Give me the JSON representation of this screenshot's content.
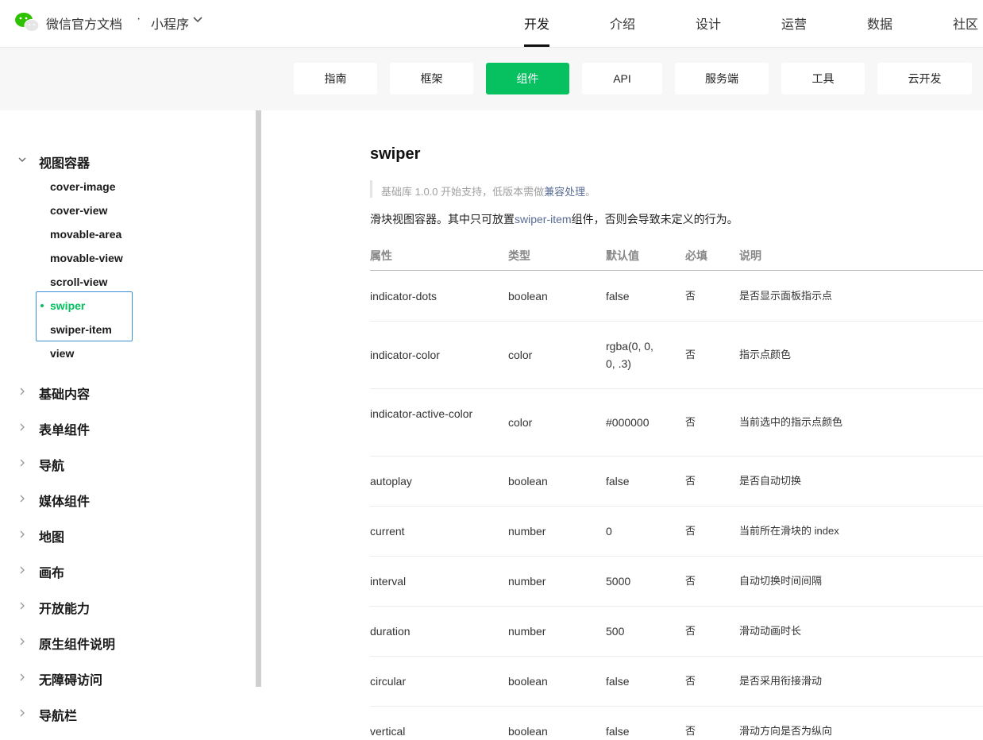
{
  "header": {
    "brand": "微信官方文档",
    "dot": "·",
    "section": "小程序",
    "nav": [
      "开发",
      "介绍",
      "设计",
      "运营",
      "数据",
      "社区"
    ]
  },
  "subnav": [
    "指南",
    "框架",
    "组件",
    "API",
    "服务端",
    "工具",
    "云开发"
  ],
  "sidebar": {
    "open_category": "视图容器",
    "items": [
      "cover-image",
      "cover-view",
      "movable-area",
      "movable-view",
      "scroll-view",
      "swiper",
      "swiper-item",
      "view"
    ],
    "categories": [
      "基础内容",
      "表单组件",
      "导航",
      "媒体组件",
      "地图",
      "画布",
      "开放能力",
      "原生组件说明",
      "无障碍访问",
      "导航栏"
    ]
  },
  "content": {
    "title": "swiper",
    "note_prefix": "基础库 1.0.0 开始支持，低版本需做",
    "note_link": "兼容处理",
    "note_suffix": "。",
    "desc_prefix": "滑块视图容器。其中只可放置",
    "desc_link": "swiper-item",
    "desc_suffix": "组件，否则会导致未定义的行为。",
    "columns": [
      "属性",
      "类型",
      "默认值",
      "必填",
      "说明"
    ],
    "rows": [
      {
        "attr": "indicator-dots",
        "type": "boolean",
        "default": "false",
        "required": "否",
        "desc": "是否显示面板指示点"
      },
      {
        "attr": "indicator-color",
        "type": "color",
        "default": "rgba(0, 0, 0, .3)",
        "required": "否",
        "desc": "指示点颜色"
      },
      {
        "attr": "indicator-active-color",
        "type": "color",
        "default": "#000000",
        "required": "否",
        "desc": "当前选中的指示点颜色"
      },
      {
        "attr": "autoplay",
        "type": "boolean",
        "default": "false",
        "required": "否",
        "desc": "是否自动切换"
      },
      {
        "attr": "current",
        "type": "number",
        "default": "0",
        "required": "否",
        "desc": "当前所在滑块的 index"
      },
      {
        "attr": "interval",
        "type": "number",
        "default": "5000",
        "required": "否",
        "desc": "自动切换时间间隔"
      },
      {
        "attr": "duration",
        "type": "number",
        "default": "500",
        "required": "否",
        "desc": "滑动动画时长"
      },
      {
        "attr": "circular",
        "type": "boolean",
        "default": "false",
        "required": "否",
        "desc": "是否采用衔接滑动"
      },
      {
        "attr": "vertical",
        "type": "boolean",
        "default": "false",
        "required": "否",
        "desc": "滑动方向是否为纵向"
      }
    ]
  },
  "colors": {
    "accent": "#07c160",
    "link": "#576b95",
    "selection": "#3a8fd6"
  }
}
